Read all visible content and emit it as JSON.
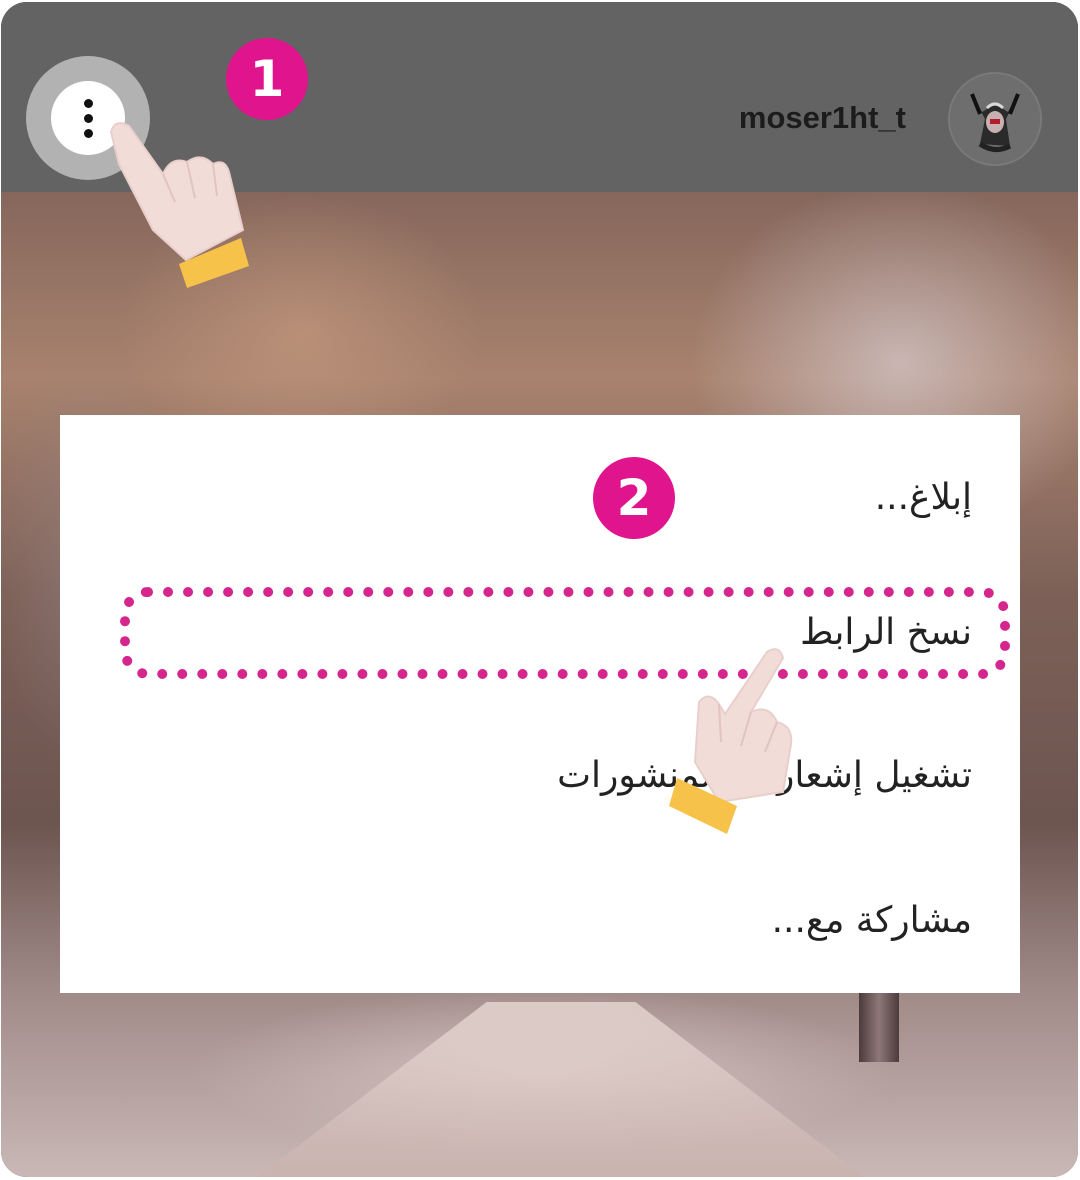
{
  "header": {
    "username": "moser1ht_t",
    "menu_icon": "more-vertical-icon",
    "avatar_icon": "profile-avatar-icon"
  },
  "steps": {
    "step1": "1",
    "step2": "2"
  },
  "menu": {
    "items": [
      {
        "label": "إبلاغ..."
      },
      {
        "label": "نسخ الرابط"
      },
      {
        "label": "تشغيل إشعارات المنشورات"
      },
      {
        "label": "مشاركة مع..."
      }
    ],
    "highlighted_index": 1
  },
  "colors": {
    "badge": "#e0148c",
    "highlight": "#d21b86",
    "topbar": "#636363",
    "hand_cuff": "#f7c24a",
    "hand_skin": "#f2dcd8"
  }
}
